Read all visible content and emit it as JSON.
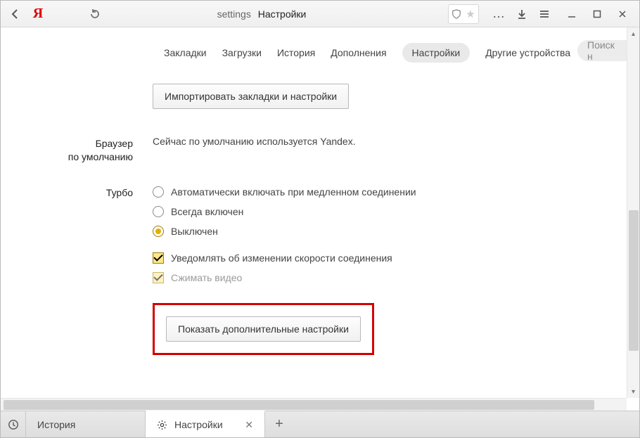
{
  "address": {
    "prefix": "settings",
    "title": "Настройки"
  },
  "nav": {
    "items": [
      "Закладки",
      "Загрузки",
      "История",
      "Дополнения",
      "Настройки",
      "Другие устройства"
    ],
    "active_index": 4,
    "search_placeholder": "Поиск н"
  },
  "import_button": "Импортировать закладки и настройки",
  "default_browser": {
    "label_line1": "Браузер",
    "label_line2": "по умолчанию",
    "status": "Сейчас по умолчанию используется Yandex."
  },
  "turbo": {
    "label": "Турбо",
    "options": [
      "Автоматически включать при медленном соединении",
      "Всегда включен",
      "Выключен"
    ],
    "selected_index": 2,
    "checkbox_notify": "Уведомлять об изменении скорости соединения",
    "checkbox_notify_checked": true,
    "checkbox_compress": "Сжимать видео",
    "checkbox_compress_checked": true
  },
  "show_advanced": "Показать дополнительные настройки",
  "tabs": {
    "history": "История",
    "settings": "Настройки"
  }
}
